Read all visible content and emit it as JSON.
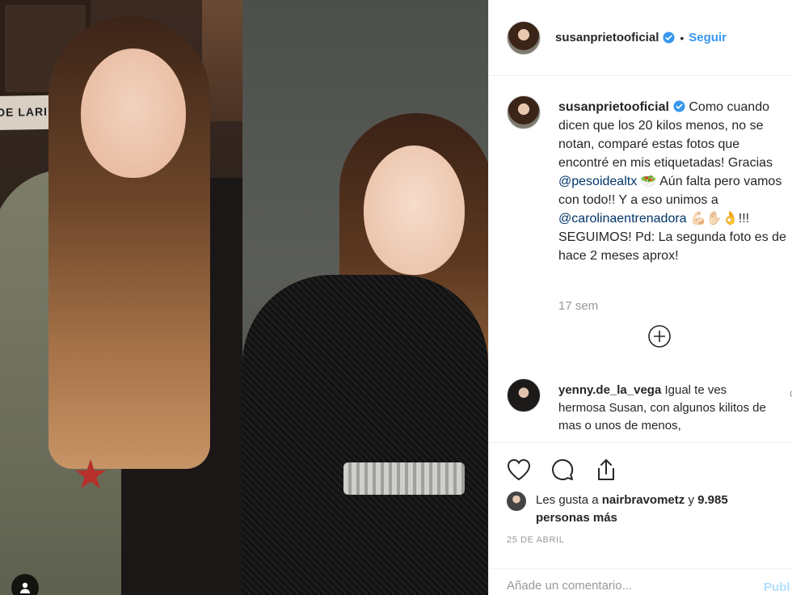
{
  "post": {
    "username": "susanprietooficial",
    "follow_separator": "•",
    "follow_label": "Seguir",
    "photo_sign_text": "DE LARINGE"
  },
  "caption": {
    "username": "susanprietooficial",
    "text_1": " Como cuando dicen que los 20 kilos menos, no se notan, comparé estas fotos que encontré en mis etiquetadas! Gracias ",
    "mention_1": "@pesoidealtx",
    "text_2": " 🥗 Aún falta pero vamos con todo!! Y a eso unimos a ",
    "mention_2": "@carolinaentrenadora",
    "text_3": " 💪🏻✋🏻👌!!! SEGUIMOS! Pd: La segunda foto es de hace 2 meses aprox!",
    "time_ago": "17 sem"
  },
  "comment": {
    "username": "yenny.de_la_vega",
    "text": " Igual te ves hermosa Susan, con algunos kilitos de mas o unos de menos,",
    "more": "c"
  },
  "likes": {
    "prefix": "Les gusta a ",
    "user": "nairbravometz",
    "suffix": " y ",
    "count": "9.985 personas más"
  },
  "date": "25 DE ABRIL",
  "add_comment": {
    "placeholder": "Añade un comentario...",
    "publish_label": "Publ"
  },
  "colors": {
    "link_blue": "#3897f0",
    "mention": "#003569",
    "muted": "#999999"
  }
}
